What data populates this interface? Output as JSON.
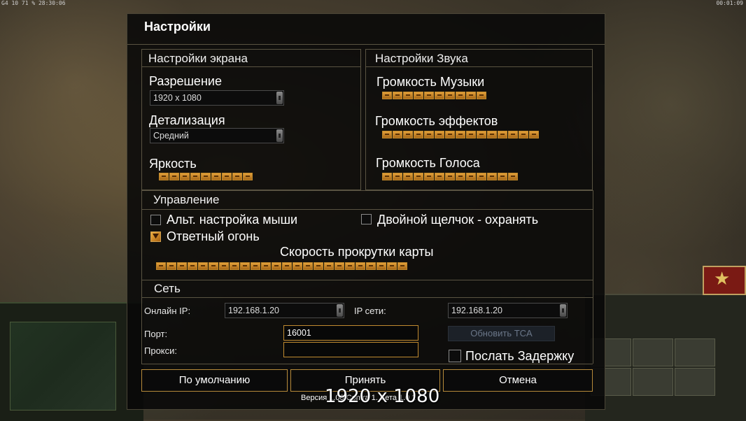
{
  "hud": {
    "top_left": "G4 10 71 %  28:30:06",
    "top_right": "00:01:09"
  },
  "dialog": {
    "title": "Настройки",
    "display": {
      "title": "Настройки экрана",
      "resolution_label": "Разрешение",
      "resolution_value": "1920 x 1080",
      "detail_label": "Детализация",
      "detail_value": "Средний",
      "brightness_label": "Яркость",
      "brightness_level": 9,
      "brightness_max": 9
    },
    "sound": {
      "title": "Настройки Звука",
      "music_label": "Громкость Музыки",
      "music_level": 10,
      "music_max": 10,
      "effects_label": "Громкость эффектов",
      "effects_level": 15,
      "effects_max": 15,
      "voice_label": "Громкость Голоса",
      "voice_level": 13,
      "voice_max": 13
    },
    "controls": {
      "title": "Управление",
      "alt_mouse_label": "Альт. настройка мыши",
      "alt_mouse_checked": false,
      "double_click_label": "Двойной щелчок - охранять",
      "double_click_checked": false,
      "return_fire_label": "Ответный огонь",
      "return_fire_checked": true,
      "scroll_label": "Скорость прокрутки карты",
      "scroll_level": 24,
      "scroll_max": 24
    },
    "network": {
      "title": "Сеть",
      "online_ip_label": "Онлайн IP:",
      "online_ip_value": "192.168.1.20",
      "lan_ip_label": "IP сети:",
      "lan_ip_value": "192.168.1.20",
      "port_label": "Порт:",
      "port_value": "16001",
      "proxy_label": "Прокси:",
      "proxy_value": "",
      "update_tca_label": "Обновить TCA",
      "send_delay_label": "Послать Задержку",
      "send_delay_checked": false
    },
    "buttons": {
      "defaults": "По умолчанию",
      "accept": "Принять",
      "cancel": "Отмена"
    },
    "version": "Версия 1.00.Contra 1. Бета 1.0 1",
    "resolution_overlay": "1920 x 1080"
  }
}
